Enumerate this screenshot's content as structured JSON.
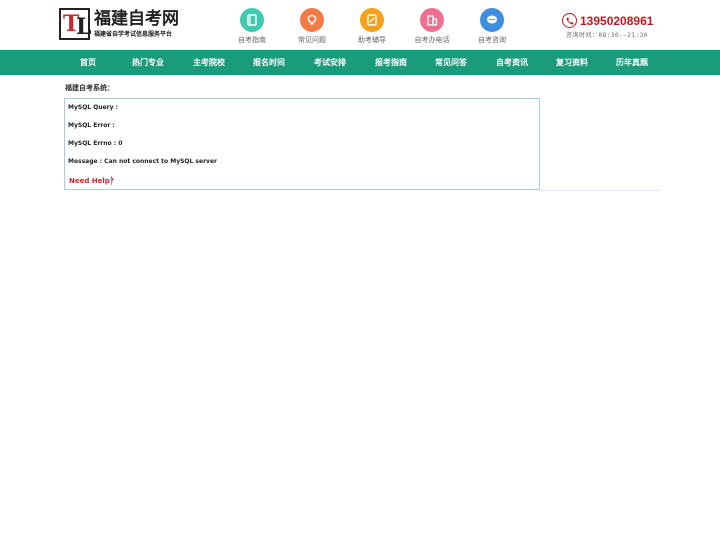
{
  "site": {
    "title": "福建自考网",
    "subtitle": "福建省自学考试信息服务平台",
    "logo_mark_t": "T",
    "logo_mark_l": "L"
  },
  "quick_links": [
    {
      "label": "自考指南",
      "icon": "book-icon",
      "color": "#3fcab2"
    },
    {
      "label": "常见问题",
      "icon": "lightbulb-icon",
      "color": "#f27a45"
    },
    {
      "label": "助考辅导",
      "icon": "pencil-icon",
      "color": "#f4a21d"
    },
    {
      "label": "自考办电话",
      "icon": "building-icon",
      "color": "#ef6f93"
    },
    {
      "label": "自考咨询",
      "icon": "chat-icon",
      "color": "#3d8ee0"
    }
  ],
  "contact": {
    "phone": "13950208961",
    "hours": "咨询时间：08:30--21:30",
    "icon": "phone-icon"
  },
  "nav": [
    "首页",
    "热门专业",
    "主考院校",
    "报名时间",
    "考试安排",
    "报考指南",
    "常见问答",
    "自考资讯",
    "复习资料",
    "历年真题"
  ],
  "content": {
    "section_title": "福建自考系统：",
    "error_lines": [
      "MySQL Query :",
      "MySQL Error :",
      "MySQL Errno : 0",
      "Message : Can not connect to MySQL server"
    ],
    "help_link": "Need Help?"
  },
  "colors": {
    "nav_bg": "#1a9b7c",
    "phone": "#c4171d",
    "help": "#d0262b"
  }
}
